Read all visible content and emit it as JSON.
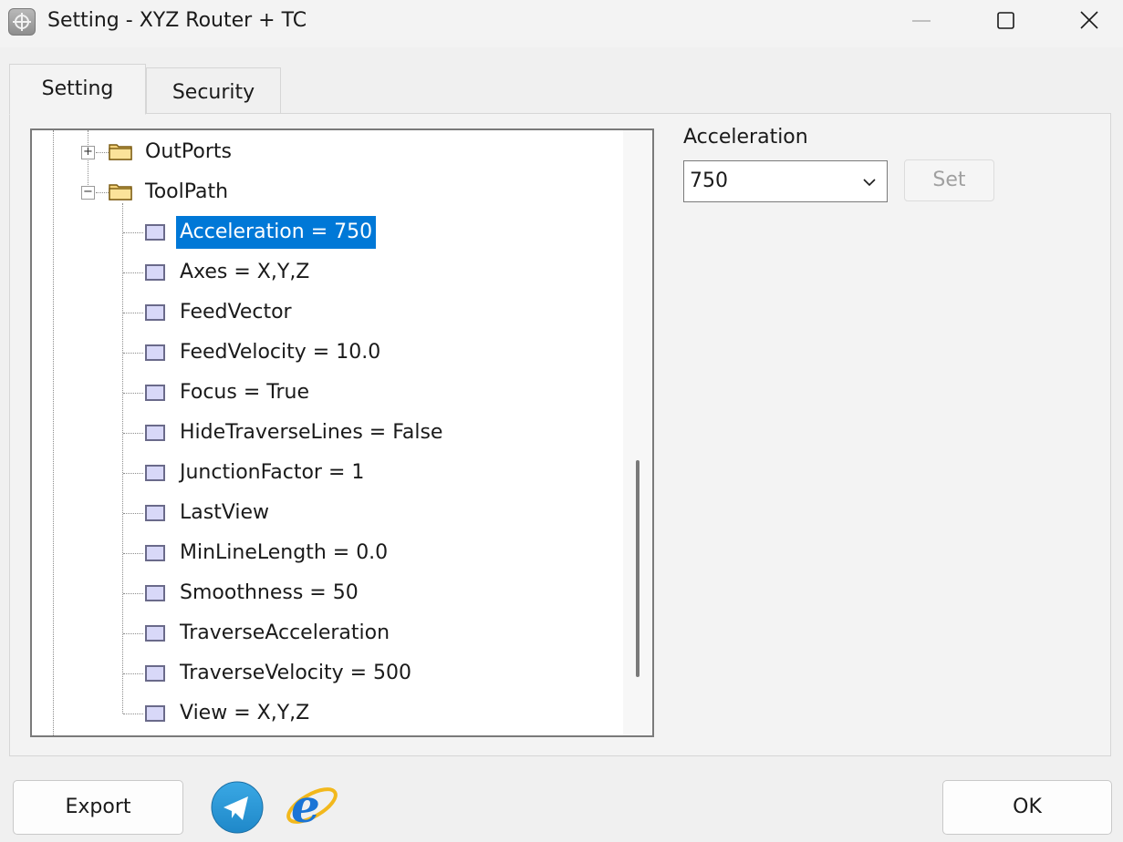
{
  "window": {
    "title": "Setting - XYZ Router + TC",
    "icons": [
      "app-icon",
      "minimize-icon",
      "maximize-icon",
      "close-icon"
    ]
  },
  "tabs": [
    {
      "label": "Setting",
      "active": true
    },
    {
      "label": "Security",
      "active": false
    }
  ],
  "tree": {
    "nodes": [
      {
        "label": "OutPorts",
        "expanded": false,
        "icon": "folder-icon"
      },
      {
        "label": "ToolPath",
        "expanded": true,
        "icon": "folder-icon"
      }
    ],
    "items": [
      {
        "label": "Acceleration = 750",
        "selected": true
      },
      {
        "label": "Axes = X,Y,Z"
      },
      {
        "label": "FeedVector"
      },
      {
        "label": "FeedVelocity = 10.0"
      },
      {
        "label": "Focus = True"
      },
      {
        "label": "HideTraverseLines = False"
      },
      {
        "label": "JunctionFactor = 1"
      },
      {
        "label": "LastView"
      },
      {
        "label": "MinLineLength = 0.0"
      },
      {
        "label": "Smoothness = 50"
      },
      {
        "label": "TraverseAcceleration"
      },
      {
        "label": "TraverseVelocity = 500"
      },
      {
        "label": "View = X,Y,Z"
      }
    ]
  },
  "editor": {
    "label": "Acceleration",
    "value": "750",
    "set_label": "Set",
    "set_enabled": false
  },
  "footer": {
    "export_label": "Export",
    "ok_label": "OK",
    "icons": [
      "telegram-icon",
      "internet-explorer-icon"
    ]
  },
  "colors": {
    "selection": "#0078d7",
    "background": "#f0f0f0"
  }
}
